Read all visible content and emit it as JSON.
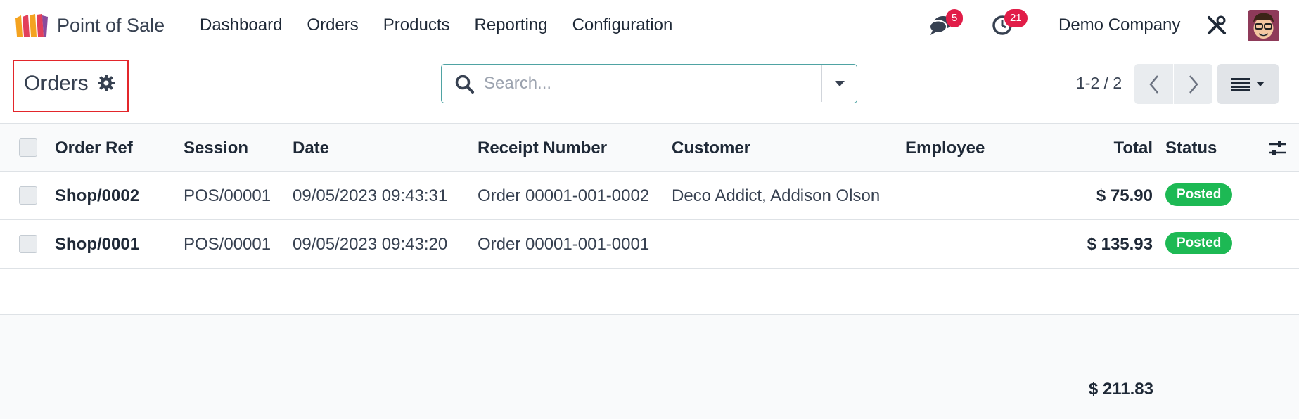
{
  "navbar": {
    "app_name": "Point of Sale",
    "menu": [
      "Dashboard",
      "Orders",
      "Products",
      "Reporting",
      "Configuration"
    ],
    "messages_count": "5",
    "activities_count": "21",
    "company": "Demo Company"
  },
  "control_panel": {
    "title": "Orders",
    "search_placeholder": "Search...",
    "pager": "1-2 / 2"
  },
  "table": {
    "columns": [
      "Order Ref",
      "Session",
      "Date",
      "Receipt Number",
      "Customer",
      "Employee",
      "Total",
      "Status"
    ],
    "rows": [
      {
        "order_ref": "Shop/0002",
        "session": "POS/00001",
        "date": "09/05/2023 09:43:31",
        "receipt_number": "Order 00001-001-0002",
        "customer": "Deco Addict, Addison Olson",
        "employee": "",
        "total": "$ 75.90",
        "status": "Posted"
      },
      {
        "order_ref": "Shop/0001",
        "session": "POS/00001",
        "date": "09/05/2023 09:43:20",
        "receipt_number": "Order 00001-001-0001",
        "customer": "",
        "employee": "",
        "total": "$ 135.93",
        "status": "Posted"
      }
    ],
    "grand_total": "$ 211.83"
  },
  "colors": {
    "status_posted": "#1db954",
    "badge": "#e11d48",
    "highlight_border": "#e3262b"
  }
}
